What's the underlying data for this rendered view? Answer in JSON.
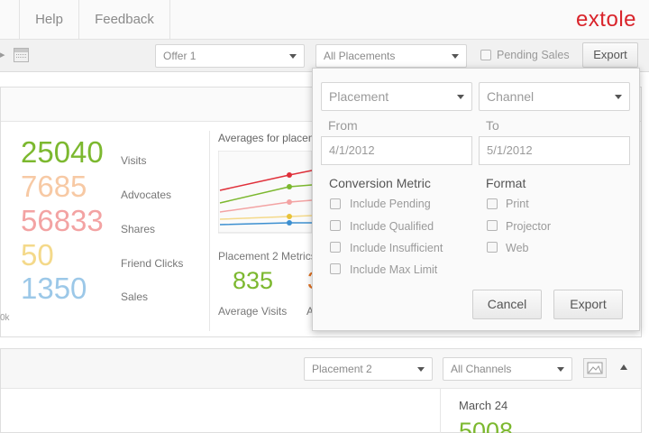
{
  "nav": {
    "help": "Help",
    "feedback": "Feedback",
    "logo": "extole"
  },
  "toolbar": {
    "offer_select": "Offer 1",
    "placements_select": "All Placements",
    "pending_sales_label": "Pending Sales",
    "export_label": "Export"
  },
  "metrics": {
    "visits": {
      "value": "25040",
      "label": "Visits",
      "color": "#7cb82f"
    },
    "advocates": {
      "value": "7685",
      "label": "Advocates",
      "color": "#f7c9a4"
    },
    "shares": {
      "value": "56833",
      "label": "Shares",
      "color": "#f3a3a3"
    },
    "friend_clicks": {
      "value": "50",
      "label": "Friend Clicks",
      "color": "#f4d98a"
    },
    "sales": {
      "value": "1350",
      "label": "Sales",
      "color": "#9cc8e8"
    },
    "axis_fragment": "0k"
  },
  "chart_panel": {
    "title": "Averages for placem",
    "placement_metrics": "Placement 2 Metrics",
    "avg_visits_value": "835",
    "avg_visits_label": "Average Visits",
    "partial_label": "A",
    "partial_value": "3"
  },
  "lower": {
    "placement_select": "Placement 2",
    "channels_select": "All Channels",
    "date": "March 24",
    "partial_value": "5008"
  },
  "popup": {
    "placement_select": "Placement",
    "channel_select": "Channel",
    "from_label": "From",
    "to_label": "To",
    "from_value": "4/1/2012",
    "to_value": "5/1/2012",
    "conversion_heading": "Conversion Metric",
    "format_heading": "Format",
    "conversion_options": [
      "Include Pending",
      "Include Qualified",
      "Include Insufficient",
      "Include Max Limit"
    ],
    "format_options": [
      "Print",
      "Projector",
      "Web"
    ],
    "cancel_label": "Cancel",
    "export_label": "Export"
  }
}
